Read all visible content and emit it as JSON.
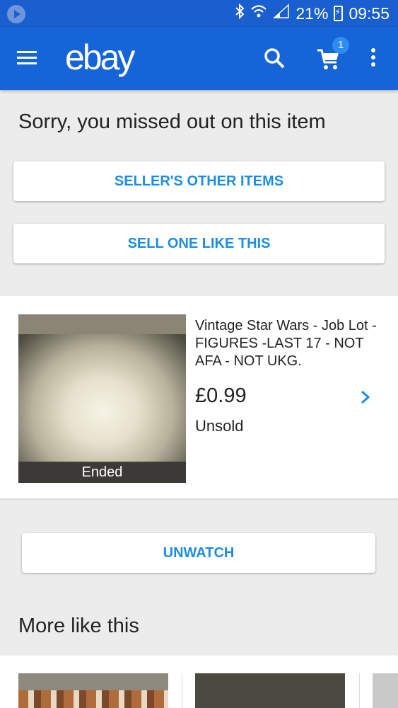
{
  "status_bar": {
    "battery": "21%",
    "time": "09:55"
  },
  "appbar": {
    "logo": "ebay",
    "cart_count": "1"
  },
  "missed": {
    "title": "Sorry, you missed out on this item",
    "sellers_other_items": "SELLER'S OTHER ITEMS",
    "sell_one_like_this": "SELL ONE LIKE THIS"
  },
  "item": {
    "title": "Vintage Star Wars - Job Lot - FIGURES -LAST 17 - NOT AFA - NOT UKG.",
    "price": "£0.99",
    "status": "Unsold",
    "thumb_label": "Ended"
  },
  "unwatch_label": "UNWATCH",
  "more_like_this": {
    "title": "More like this"
  },
  "colors": {
    "appbar": "#1565d8",
    "statusbar": "#1a5fcf",
    "accent": "#1d8de4"
  },
  "icons": [
    "play-icon",
    "bluetooth-icon",
    "wifi-icon",
    "signal-icon",
    "battery-icon",
    "menu-icon",
    "search-icon",
    "cart-icon",
    "overflow-menu-icon",
    "chevron-right-icon"
  ]
}
